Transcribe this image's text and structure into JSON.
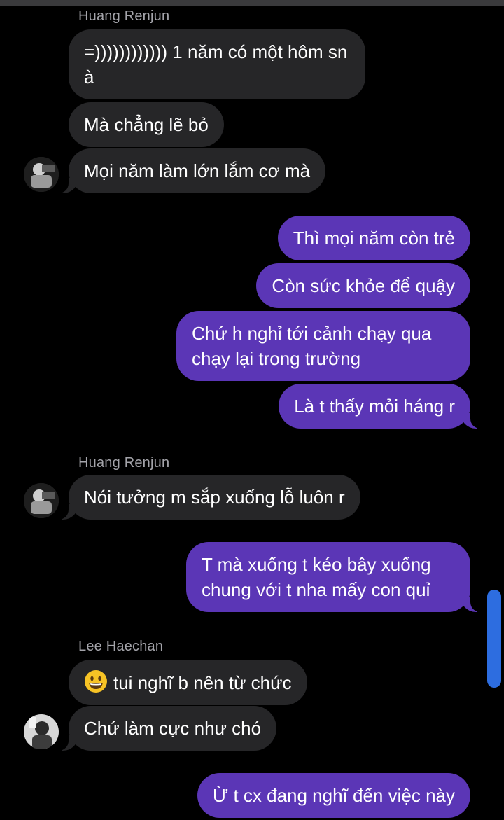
{
  "chat": {
    "messages": [
      {
        "sender": "Huang Renjun",
        "text": "=)))))))))))) 1 năm có một hôm sn à"
      },
      {
        "text": "Mà chẳng lẽ bỏ"
      },
      {
        "text": "Mọi năm làm lớn lắm cơ mà"
      },
      {
        "text": "Thì mọi năm còn trẻ"
      },
      {
        "text": "Còn sức khỏe để quậy"
      },
      {
        "text": "Chứ h nghỉ tới cảnh chạy qua chạy lại trong trường"
      },
      {
        "text": "Là t thấy mỏi háng r"
      },
      {
        "sender": "Huang Renjun",
        "text": "Nói tưởng m sắp xuống lỗ luôn r"
      },
      {
        "text": "T mà xuống t kéo bây xuống chung với t nha mấy con quỉ"
      },
      {
        "sender": "Lee Haechan",
        "text": "tui nghĩ b nên từ chức",
        "emoji": "grinning-face"
      },
      {
        "text": "Chứ làm cực như chó"
      },
      {
        "text": "Ừ t cx đang nghĩ đến việc này"
      }
    ]
  },
  "colors": {
    "incoming_bubble": "#262628",
    "outgoing_bubble": "#5b36b6",
    "background": "#000000",
    "sender_name": "#a4a4aa",
    "scrollbar": "#2d6de0"
  }
}
